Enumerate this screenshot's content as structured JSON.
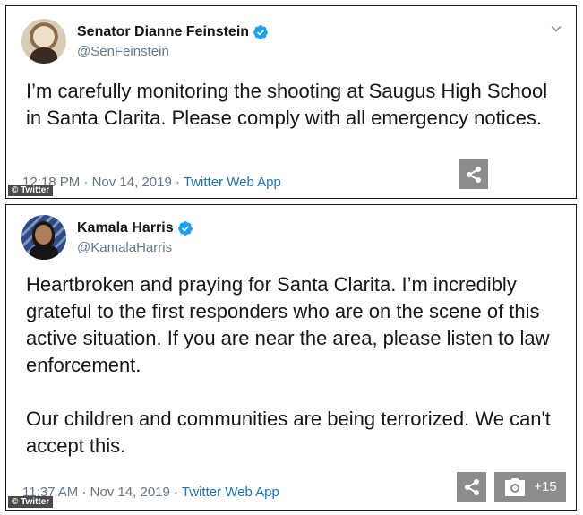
{
  "tweets": [
    {
      "display_name": "Senator Dianne Feinstein",
      "handle": "@SenFeinstein",
      "text": "I’m carefully monitoring the shooting at Saugus High School in Santa Clarita. Please comply with all emergency notices.",
      "time": "12:18 PM",
      "separator": "·",
      "date": "Nov 14, 2019",
      "app": "Twitter Web App",
      "watermark": "© Twitter",
      "avatar_icon": "avatar-feinstein",
      "verified_icon": "verified-badge-icon"
    },
    {
      "display_name": "Kamala Harris",
      "handle": "@KamalaHarris",
      "text": "Heartbroken and praying for Santa Clarita. I’m incredibly grateful to the first responders who are on the scene of this active situation. If you are near the area, please listen to law enforcement.\n\nOur children and communities are being terrorized. We can't accept this.",
      "time": "11:37 AM",
      "separator": "·",
      "date": "Nov 14, 2019",
      "app": "Twitter Web App",
      "watermark": "© Twitter",
      "gallery_count": "+15",
      "avatar_icon": "avatar-harris",
      "verified_icon": "verified-badge-icon"
    }
  ],
  "colors": {
    "verified": "#1da1f2",
    "link": "#1b74b3",
    "muted": "#657786",
    "overlay_button": "#8c8c8c"
  }
}
